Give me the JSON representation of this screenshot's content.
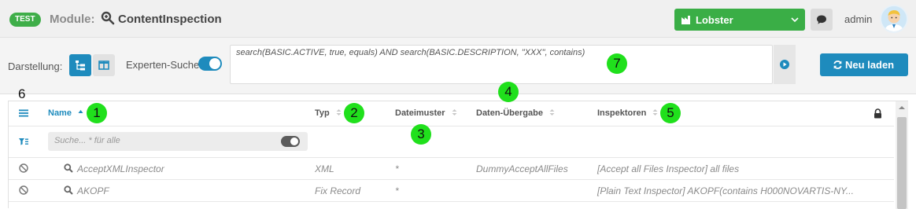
{
  "header": {
    "env_badge": "TEST",
    "module_label": "Module:",
    "module_name": "ContentInspection",
    "tenant": "Lobster",
    "user": "admin",
    "colors": {
      "badge": "#3fae49",
      "tenant": "#3aae46",
      "accent": "#1e8bbd"
    }
  },
  "toolbar": {
    "view_label": "Darstellung:",
    "expert_label": "Experten-Suche",
    "expert_enabled": true,
    "query": "search(BASIC.ACTIVE, true, equals) AND search(BASIC.DESCRIPTION, \"XXX\", contains)",
    "reload_label": "Neu laden"
  },
  "grid": {
    "columns": [
      "Name",
      "Typ",
      "Dateimuster",
      "Daten-Übergabe",
      "Inspektoren"
    ],
    "search_placeholder": "Suche... * für alle",
    "rows": [
      {
        "name": "AcceptXMLInspector",
        "type": "XML",
        "pattern": "*",
        "handover": "DummyAcceptAllFiles",
        "inspectors": "[Accept all Files Inspector] all files"
      },
      {
        "name": "AKOPF",
        "type": "Fix Record",
        "pattern": "*",
        "handover": "",
        "inspectors": "[Plain Text Inspector] AKOPF(contains H000NOVARTIS-NY..."
      }
    ]
  },
  "markers": {
    "m1": "1",
    "m2": "2",
    "m3": "3",
    "m4": "4",
    "m5": "5",
    "m6": "6",
    "m7": "7"
  }
}
